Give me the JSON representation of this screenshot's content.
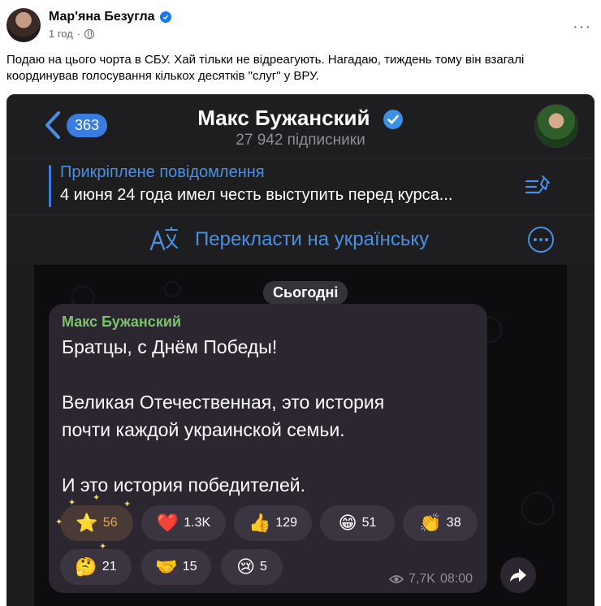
{
  "post": {
    "author": "Мар'яна Безугла",
    "time": "1 год",
    "separator": "·",
    "more": "···",
    "text": "Подаю на цього чорта в СБУ. Хай тільки не відреагують. Нагадаю, тиждень тому він взагалі координував голосування кількох десятків \"слуг\" у ВРУ."
  },
  "telegram": {
    "back_count": "363",
    "channel_name": "Макс Бужанский",
    "subscribers": "27 942 підписники",
    "pinned_title": "Прикріплене повідомлення",
    "pinned_text": "4 июня 24 года имел честь выступить перед курса...",
    "translate_label": "Перекласти на українську",
    "date_pill": "Сьогодні",
    "message": {
      "author": "Макс Бужанский",
      "lines": [
        "Братцы, с Днём Победы!",
        "Великая Отечественная, это история",
        "почти каждой украинской семьи.",
        "И это история победителей."
      ],
      "views": "7,7K",
      "time": "08:00"
    },
    "reactions": [
      {
        "emoji": "⭐",
        "count": "56"
      },
      {
        "emoji": "❤️",
        "count": "1.3K"
      },
      {
        "emoji": "👍",
        "count": "129"
      },
      {
        "emoji": "😁",
        "count": "51"
      },
      {
        "emoji": "👏",
        "count": "38"
      },
      {
        "emoji": "🤔",
        "count": "21"
      },
      {
        "emoji": "🤝",
        "count": "15"
      },
      {
        "emoji": "😢",
        "count": "5"
      }
    ]
  }
}
